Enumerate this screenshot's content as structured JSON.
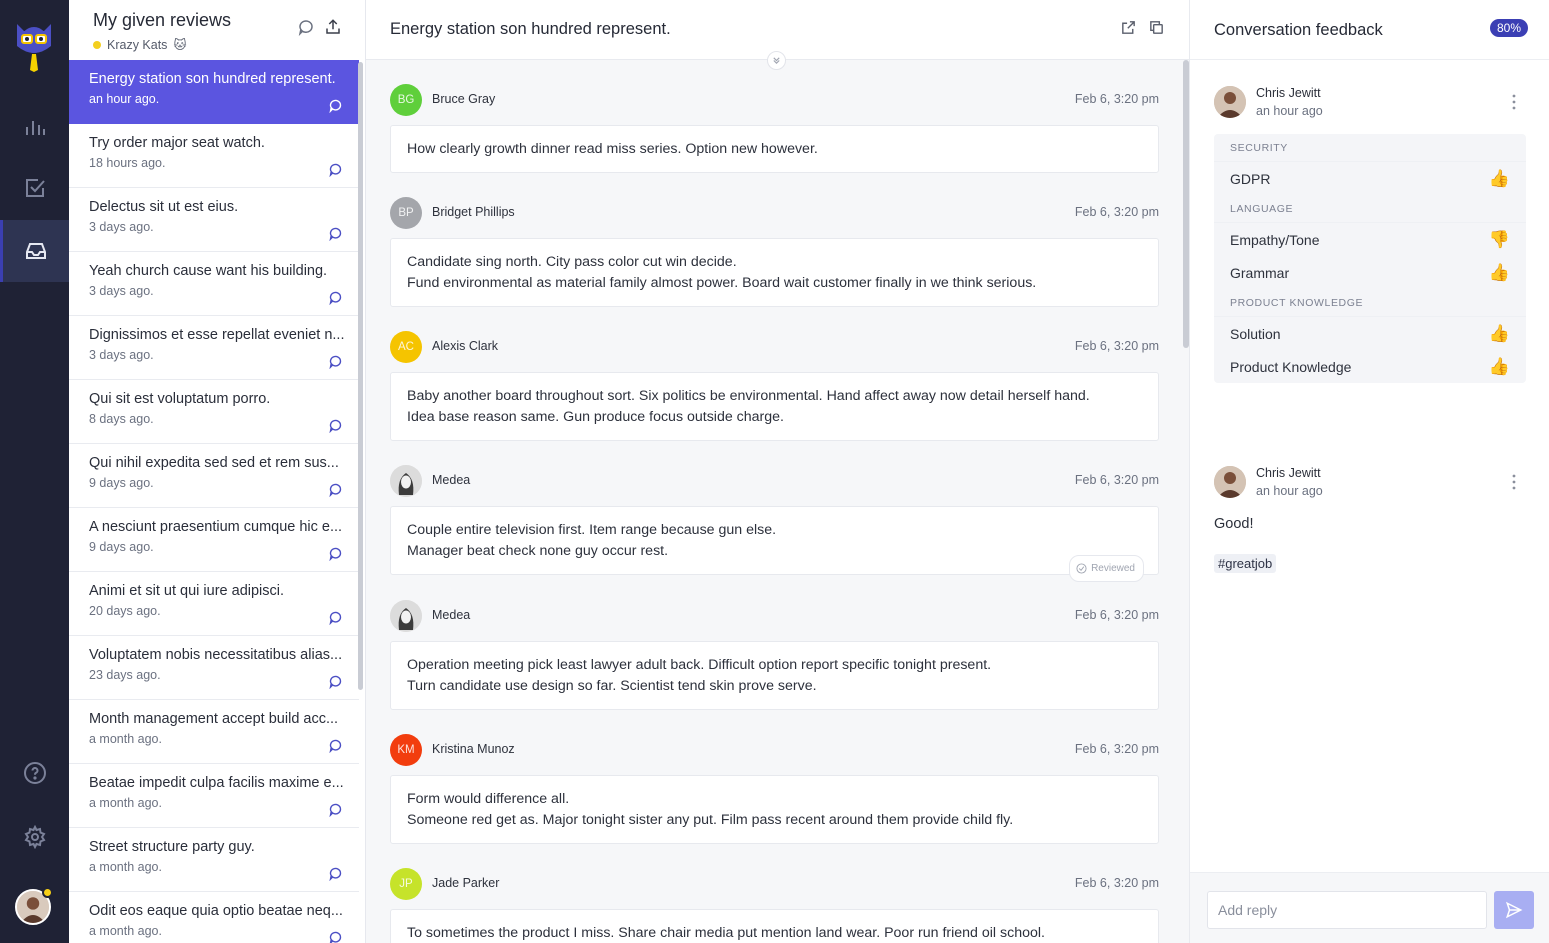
{
  "sidebar": {
    "nav": [
      "chart-icon",
      "checkbox-icon",
      "inbox-icon"
    ],
    "bottom": [
      "help-icon",
      "settings-icon"
    ]
  },
  "reviews_panel": {
    "title": "My given reviews",
    "team": "Krazy Kats",
    "team_emoji": "🐱",
    "items": [
      {
        "title": "Energy station son hundred represent.",
        "time": "an hour ago."
      },
      {
        "title": "Try order major seat watch.",
        "time": "18 hours ago."
      },
      {
        "title": "Delectus sit ut est eius.",
        "time": "3 days ago."
      },
      {
        "title": "Yeah church cause want his building.",
        "time": "3 days ago."
      },
      {
        "title": "Dignissimos et esse repellat eveniet n...",
        "time": "3 days ago."
      },
      {
        "title": "Qui sit est voluptatum porro.",
        "time": "8 days ago."
      },
      {
        "title": "Qui nihil expedita sed sed et rem sus...",
        "time": "9 days ago."
      },
      {
        "title": "A nesciunt praesentium cumque hic e...",
        "time": "9 days ago."
      },
      {
        "title": "Animi et sit ut qui iure adipisci.",
        "time": "20 days ago."
      },
      {
        "title": "Voluptatem nobis necessitatibus alias...",
        "time": "23 days ago."
      },
      {
        "title": "Month management accept build acc...",
        "time": "a month ago."
      },
      {
        "title": "Beatae impedit culpa facilis maxime e...",
        "time": "a month ago."
      },
      {
        "title": "Street structure party guy.",
        "time": "a month ago."
      },
      {
        "title": "Odit eos eaque quia optio beatae neq...",
        "time": "a month ago."
      }
    ]
  },
  "conversation": {
    "title": "Energy station son hundred represent.",
    "messages": [
      {
        "initials": "BG",
        "name": "Bruce Gray",
        "time": "Feb 6, 3:20 pm",
        "color": "#5fcf3b",
        "lines": [
          "How clearly growth dinner read miss series. Option new however."
        ]
      },
      {
        "initials": "BP",
        "name": "Bridget Phillips",
        "time": "Feb 6, 3:20 pm",
        "color": "#a4a6ab",
        "lines": [
          "Candidate sing north. City pass color cut win decide.",
          "Fund environmental as material family almost power. Board wait customer finally in we think serious."
        ]
      },
      {
        "initials": "AC",
        "name": "Alexis Clark",
        "time": "Feb 6, 3:20 pm",
        "color": "#f5c400",
        "lines": [
          "Baby another board throughout sort. Six politics be environmental. Hand affect away now detail herself hand.",
          "Idea base reason same. Gun produce focus outside charge."
        ]
      },
      {
        "initials": "",
        "name": "Medea",
        "time": "Feb 6, 3:20 pm",
        "color": "#8d8f94",
        "lines": [
          "Couple entire television first. Item range because gun else.",
          "Manager beat check none guy occur rest."
        ],
        "reviewed": "Reviewed"
      },
      {
        "initials": "",
        "name": "Medea",
        "time": "Feb 6, 3:20 pm",
        "color": "#8d8f94",
        "lines": [
          "Operation meeting pick least lawyer adult back. Difficult option report specific tonight present.",
          "Turn candidate use design so far. Scientist tend skin prove serve."
        ]
      },
      {
        "initials": "KM",
        "name": "Kristina Munoz",
        "time": "Feb 6, 3:20 pm",
        "color": "#f23d0e",
        "lines": [
          "Form would difference all.",
          "Someone red get as. Major tonight sister any put. Film pass recent around them provide child fly."
        ]
      },
      {
        "initials": "JP",
        "name": "Jade Parker",
        "time": "Feb 6, 3:20 pm",
        "color": "#c6e32a",
        "lines": [
          "To sometimes the product I miss. Share chair media put mention land wear. Poor run friend oil school."
        ]
      }
    ]
  },
  "feedback": {
    "title": "Conversation feedback",
    "score": "80%",
    "review1": {
      "name": "Chris Jewitt",
      "time": "an hour ago",
      "categories": [
        {
          "name": "SECURITY",
          "rows": [
            {
              "label": "GDPR",
              "rating": "👍"
            }
          ]
        },
        {
          "name": "LANGUAGE",
          "rows": [
            {
              "label": "Empathy/Tone",
              "rating": "👎"
            },
            {
              "label": "Grammar",
              "rating": "👍"
            }
          ]
        },
        {
          "name": "PRODUCT KNOWLEDGE",
          "rows": [
            {
              "label": "Solution",
              "rating": "👍"
            },
            {
              "label": "Product Knowledge",
              "rating": "👍"
            }
          ]
        }
      ]
    },
    "review2": {
      "name": "Chris Jewitt",
      "time": "an hour ago",
      "comment": "Good!",
      "tag": "#greatjob"
    },
    "reply_placeholder": "Add reply"
  },
  "colors": {
    "accent": "#5b55e0",
    "rail": "#1f2235",
    "badge": "#3b3fb4"
  }
}
